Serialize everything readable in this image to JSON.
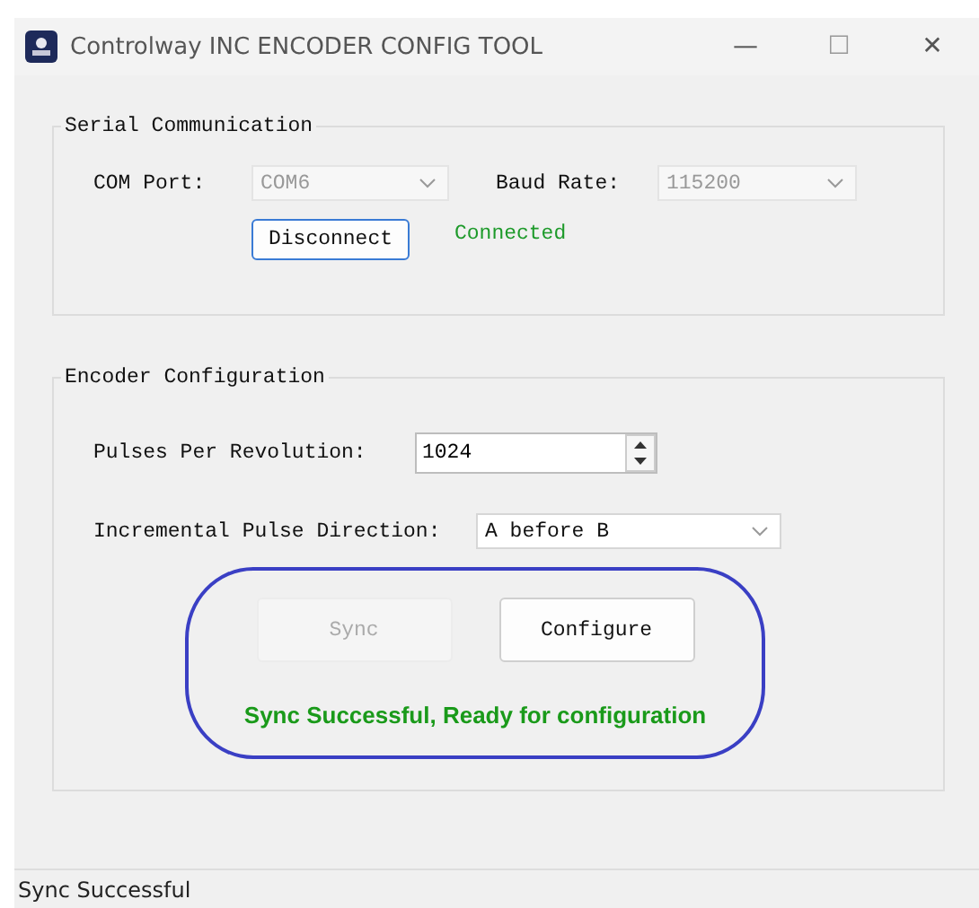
{
  "window": {
    "title": "Controlway INC ENCODER CONFIG TOOL",
    "controls": [
      "—",
      "☐",
      "✕"
    ]
  },
  "serial": {
    "title": "Serial Communication",
    "com_label": "COM Port:",
    "com_value": "COM6",
    "com_disabled": true,
    "baud_label": "Baud Rate:",
    "baud_value": "115200",
    "baud_disabled": true,
    "connect_button": "Disconnect",
    "status": "Connected"
  },
  "encoder": {
    "title": "Encoder Configuration",
    "ppr_label": "Pulses Per Revolution:",
    "ppr_value": "1024",
    "direction_label": "Incremental Pulse Direction:",
    "direction_value": "A before B",
    "buttons": [
      {
        "label": "Sync",
        "disabled": true
      },
      {
        "label": "Configure",
        "disabled": false
      }
    ],
    "message": "Sync Successful, Ready for configuration"
  },
  "status_bar": "Sync Successful"
}
